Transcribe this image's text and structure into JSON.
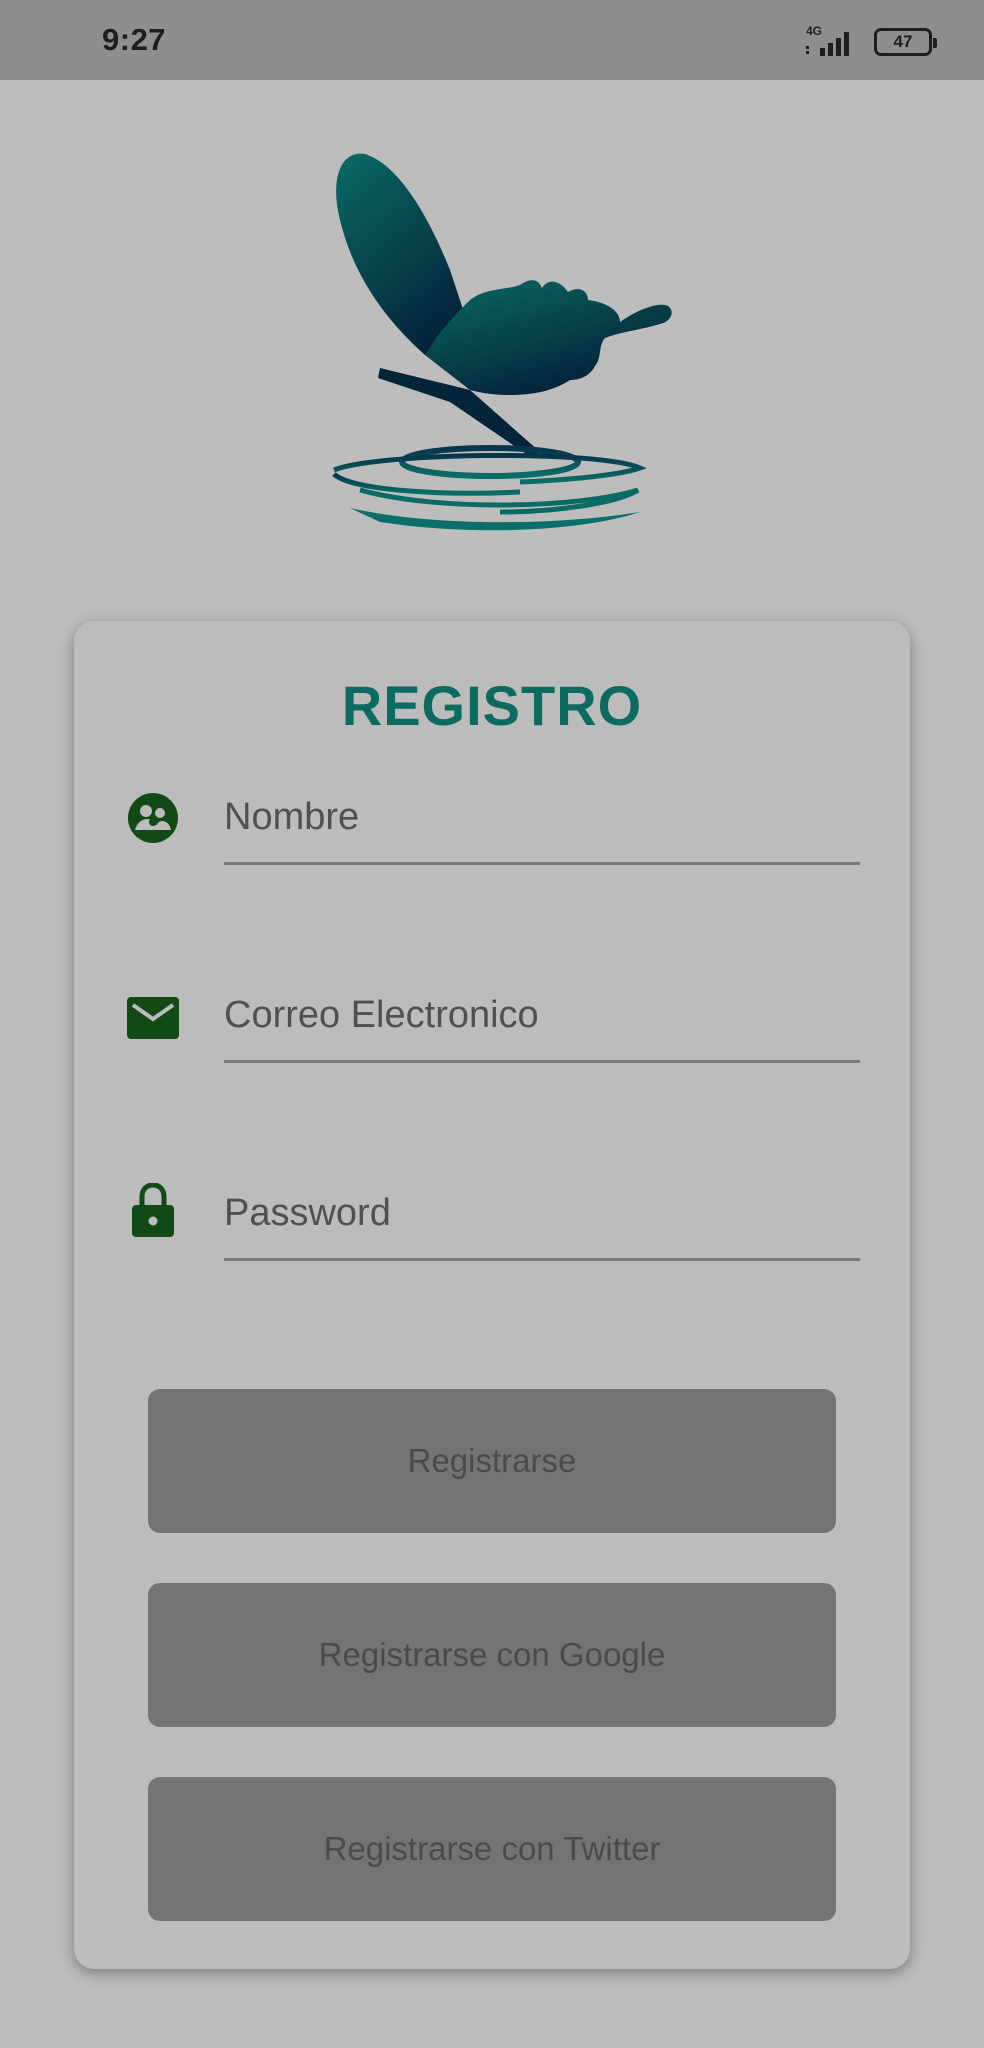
{
  "status_bar": {
    "time": "9:27",
    "network": "4G",
    "battery": "47"
  },
  "register_form": {
    "title": "REGISTRO",
    "fields": [
      {
        "icon": "group-icon",
        "placeholder": "Nombre",
        "value": ""
      },
      {
        "icon": "mail-icon",
        "placeholder": "Correo Electronico",
        "value": ""
      },
      {
        "icon": "lock-icon",
        "placeholder": "Password",
        "value": ""
      }
    ],
    "buttons": {
      "register": "Registrarse",
      "google": "Registrarse con Google",
      "twitter": "Registrarse con Twitter"
    }
  },
  "colors": {
    "title": "#0b6b61",
    "icon": "#124a16",
    "button": "#747474",
    "background": "#bdbdbd",
    "status_bar": "#8e8e8e"
  }
}
